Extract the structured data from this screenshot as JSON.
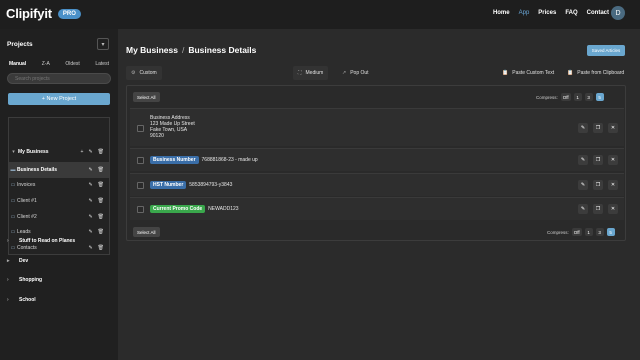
{
  "app": {
    "logo_text": "Clipifyit",
    "badge": "PRO",
    "user_initial": "D"
  },
  "nav": [
    "Home",
    "App",
    "Prices",
    "FAQ",
    "Contact"
  ],
  "sidebar": {
    "title": "Projects",
    "sort_options": [
      "Manual",
      "Z-A",
      "Oldest",
      "Latest"
    ],
    "search_placeholder": "Search projects",
    "new_project_label": "+ New Project",
    "tree": [
      {
        "label": "My Business",
        "bold": true
      },
      {
        "label": "Business Details",
        "bold": true
      },
      {
        "label": "Invoices"
      },
      {
        "label": "Client #1"
      },
      {
        "label": "Client #2"
      },
      {
        "label": "Leads"
      },
      {
        "label": "Contacts"
      }
    ],
    "root_projects": [
      "Stuff to Read on Planes",
      "Dev",
      "Shopping",
      "School"
    ]
  },
  "main": {
    "breadcrumb": [
      "My Business",
      "Business Details"
    ],
    "saved_label": "Saved Articles",
    "toolbar": {
      "custom": "Custom",
      "medium": "Medium",
      "popout": "Pop Out",
      "paste_custom": "Paste Custom Text",
      "paste_clipboard": "Paste from Clipboard"
    },
    "select_all": "Select All",
    "compress_label_top": "Compress:",
    "compress_label_bottom": "Compress:",
    "compress_options": [
      "Off",
      "1",
      "3",
      "5"
    ],
    "compress_active": "5",
    "clips": [
      {
        "type": "text",
        "lines": [
          "Business Address",
          "123 Made Up Street",
          "Fake Town, USA",
          "90120"
        ]
      },
      {
        "type": "tagged",
        "tag": "Business Number",
        "tag_color": "#3a6ea8",
        "value": "768881868-23 - made up"
      },
      {
        "type": "tagged",
        "tag": "HST Number",
        "tag_color": "#3a6ea8",
        "value": "5853894793-y3843"
      },
      {
        "type": "tagged",
        "tag": "Current Promo Code",
        "tag_color": "#3aa84c",
        "value": "NEWADD123"
      }
    ]
  }
}
